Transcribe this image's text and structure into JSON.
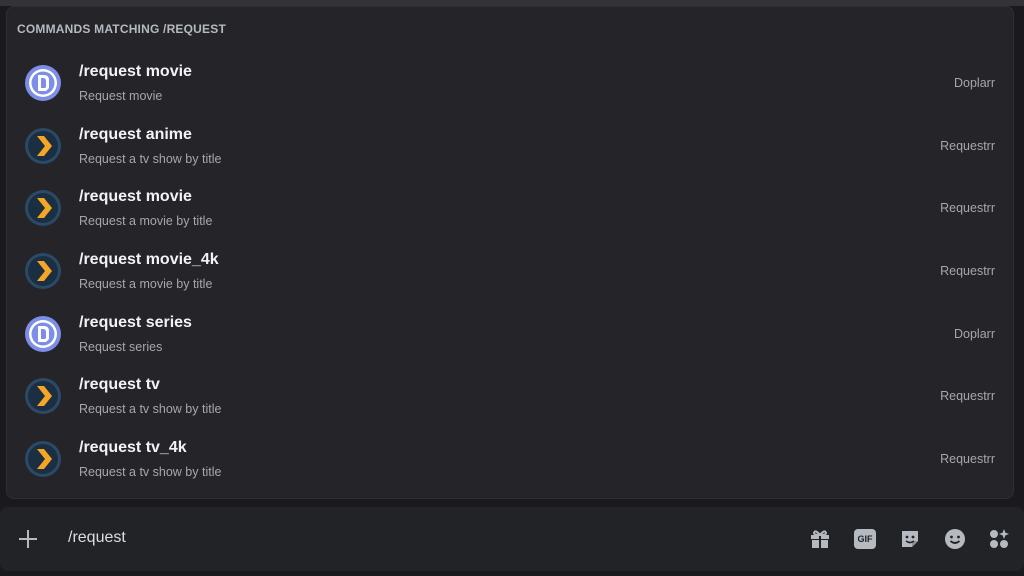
{
  "popup": {
    "header": "COMMANDS MATCHING /REQUEST",
    "commands": [
      {
        "name": "/request movie",
        "description": "Request movie",
        "source": "Doplarr",
        "icon": "doplarr-bot-icon"
      },
      {
        "name": "/request anime",
        "description": "Request a tv show by title",
        "source": "Requestrr",
        "icon": "requestrr-bot-icon"
      },
      {
        "name": "/request movie",
        "description": "Request a movie by title",
        "source": "Requestrr",
        "icon": "requestrr-bot-icon"
      },
      {
        "name": "/request movie_4k",
        "description": "Request a movie by title",
        "source": "Requestrr",
        "icon": "requestrr-bot-icon"
      },
      {
        "name": "/request series",
        "description": "Request series",
        "source": "Doplarr",
        "icon": "doplarr-bot-icon"
      },
      {
        "name": "/request tv",
        "description": "Request a tv show by title",
        "source": "Requestrr",
        "icon": "requestrr-bot-icon"
      },
      {
        "name": "/request tv_4k",
        "description": "Request a tv show by title",
        "source": "Requestrr",
        "icon": "requestrr-bot-icon"
      }
    ]
  },
  "input": {
    "value": "/request",
    "tools": {
      "gif_label": "GIF",
      "gift_icon": "gift-icon",
      "sticker_icon": "sticker-icon",
      "emoji_icon": "emoji-icon",
      "apps_icon": "apps-icon"
    }
  },
  "colors": {
    "popup_bg": "#242429",
    "page_bg": "#1a1a1e",
    "doplarr_blue": "#7c8ee8",
    "requestrr_orange": "#f5a623"
  }
}
